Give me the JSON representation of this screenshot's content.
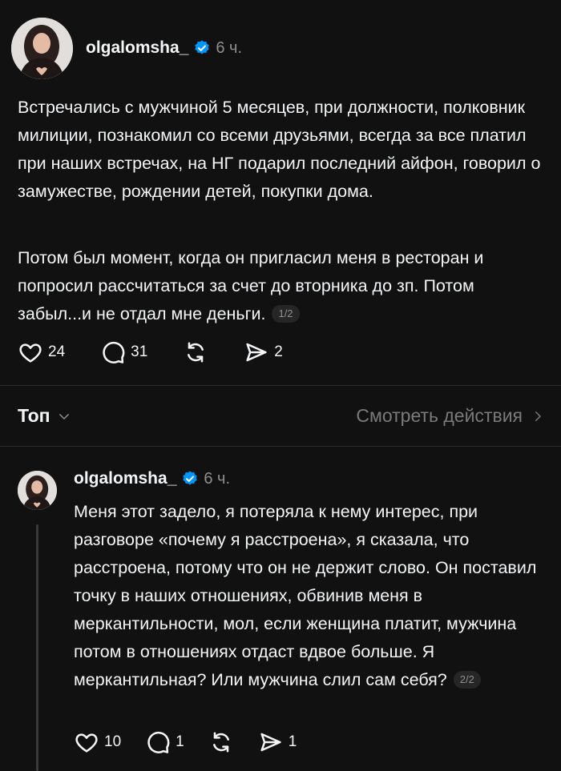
{
  "post": {
    "username": "olgalomsha_",
    "time": "6 ч.",
    "paragraphs": [
      "Встречались с мужчиной 5 месяцев, при должности, полковник милиции, познакомил со всеми друзьями, всегда за все платил при наших встречах, на НГ подарил последний айфон, говорил о замужестве, рождении детей, покупки дома.",
      "Потом был момент, когда он пригласил меня в ресторан и попросил рассчитаться за счет до вторника до зп. Потом забыл...и не отдал мне деньги."
    ],
    "page_badge": "1/2",
    "likes": "24",
    "comments": "31",
    "shares": "2"
  },
  "sort": {
    "label": "Топ",
    "activity_label": "Смотреть действия"
  },
  "reply": {
    "username": "olgalomsha_",
    "time": "6 ч.",
    "text": "Меня этот задело, я потеряла к нему интерес, при разговоре «почему я расстроена», я сказала, что расстроена, потому что он не держит слово. Он поставил точку в наших отношениях, обвинив меня в меркантильности, мол, если женщина платит, мужчина потом в отношениях отдаст вдвое больше. Я меркантильная? Или мужчина слил сам себя?",
    "page_badge": "2/2",
    "likes": "10",
    "comments": "1",
    "shares": "1"
  },
  "colors": {
    "background": "#111111",
    "text": "#f3f5f7",
    "muted": "#8f8f8f",
    "verified": "#0095f6"
  },
  "icons": [
    "verified-badge-icon",
    "heart-icon",
    "comment-icon",
    "repost-icon",
    "share-icon",
    "chevron-down-icon",
    "chevron-right-icon"
  ]
}
